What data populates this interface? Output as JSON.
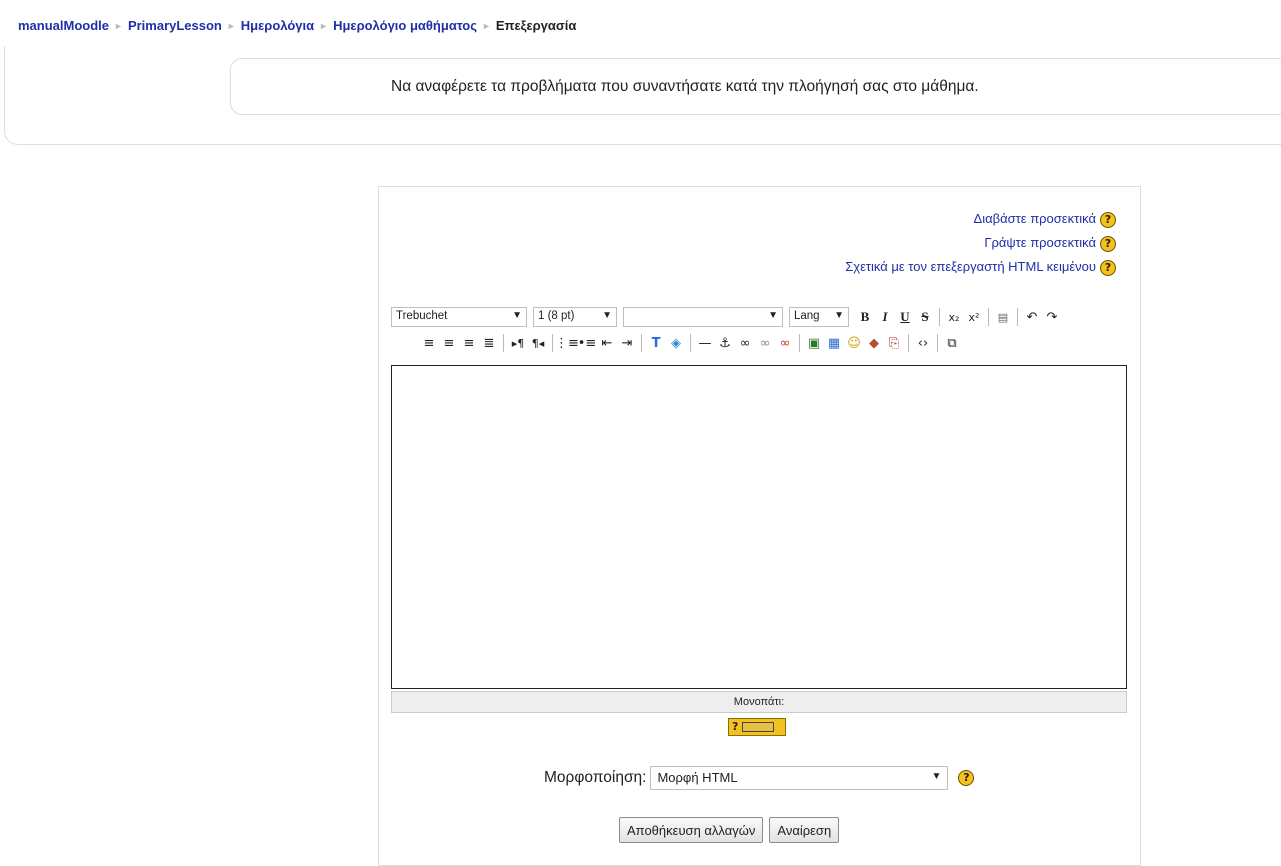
{
  "breadcrumb": {
    "items": [
      "manualMoodle",
      "PrimaryLesson",
      "Ημερολόγια",
      "Ημερολόγιο μαθήματος"
    ],
    "current": "Επεξεργασία",
    "separator": "►"
  },
  "intro": {
    "text": "Να αναφέρετε τα προβλήματα που συναντήσατε κατά την πλοήγησή σας στο μάθημα."
  },
  "help_links": {
    "read_carefully": "Διαβάστε προσεκτικά",
    "write_carefully": "Γράψτε προσεκτικά",
    "about_editor": "Σχετικά με τον επεξεργαστή HTML κειμένου"
  },
  "toolbar": {
    "font_family": "Trebuchet",
    "font_size": "1 (8 pt)",
    "heading": "",
    "lang": "Lang",
    "bold": "B",
    "italic": "I",
    "underline": "U",
    "strike": "S"
  },
  "editor": {
    "path_label": "Μονοπάτι:",
    "content": ""
  },
  "keyboard": {
    "label": "?"
  },
  "format": {
    "label": "Μορφοποίηση:",
    "selected": "Μορφή HTML"
  },
  "buttons": {
    "save": "Αποθήκευση αλλαγών",
    "cancel": "Αναίρεση"
  },
  "colors": {
    "link": "#1f2fa9",
    "help_icon": "#f3c222",
    "border": "#dddddd"
  }
}
